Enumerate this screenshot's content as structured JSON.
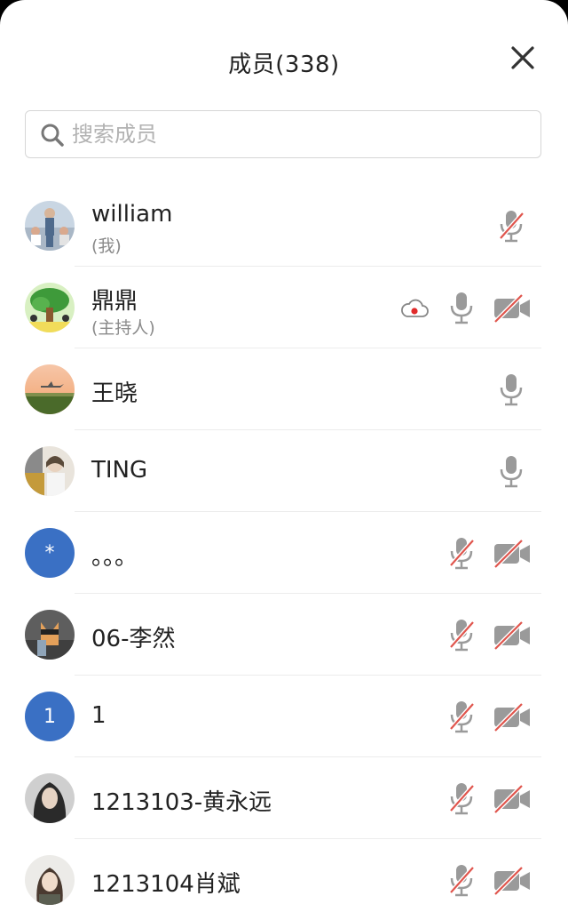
{
  "header": {
    "title": "成员(338)"
  },
  "search": {
    "placeholder": "搜索成员",
    "value": ""
  },
  "members": [
    {
      "name": "william",
      "role": "(我)"
    },
    {
      "name": "鼎鼎",
      "role": "(主持人)"
    },
    {
      "name": "王晓"
    },
    {
      "name": "TING"
    },
    {
      "name": "。。。",
      "avatar_text": "*"
    },
    {
      "name": "06-李然"
    },
    {
      "name": "1",
      "avatar_text": "1"
    },
    {
      "name": "1213103-黄永远"
    },
    {
      "name": "1213104肖斌"
    }
  ],
  "colors": {
    "muted_red": "#e0554d",
    "icon_gray": "#8f8f8f",
    "avatar_blue": "#3a70c4",
    "record_red": "#e02a2a"
  }
}
